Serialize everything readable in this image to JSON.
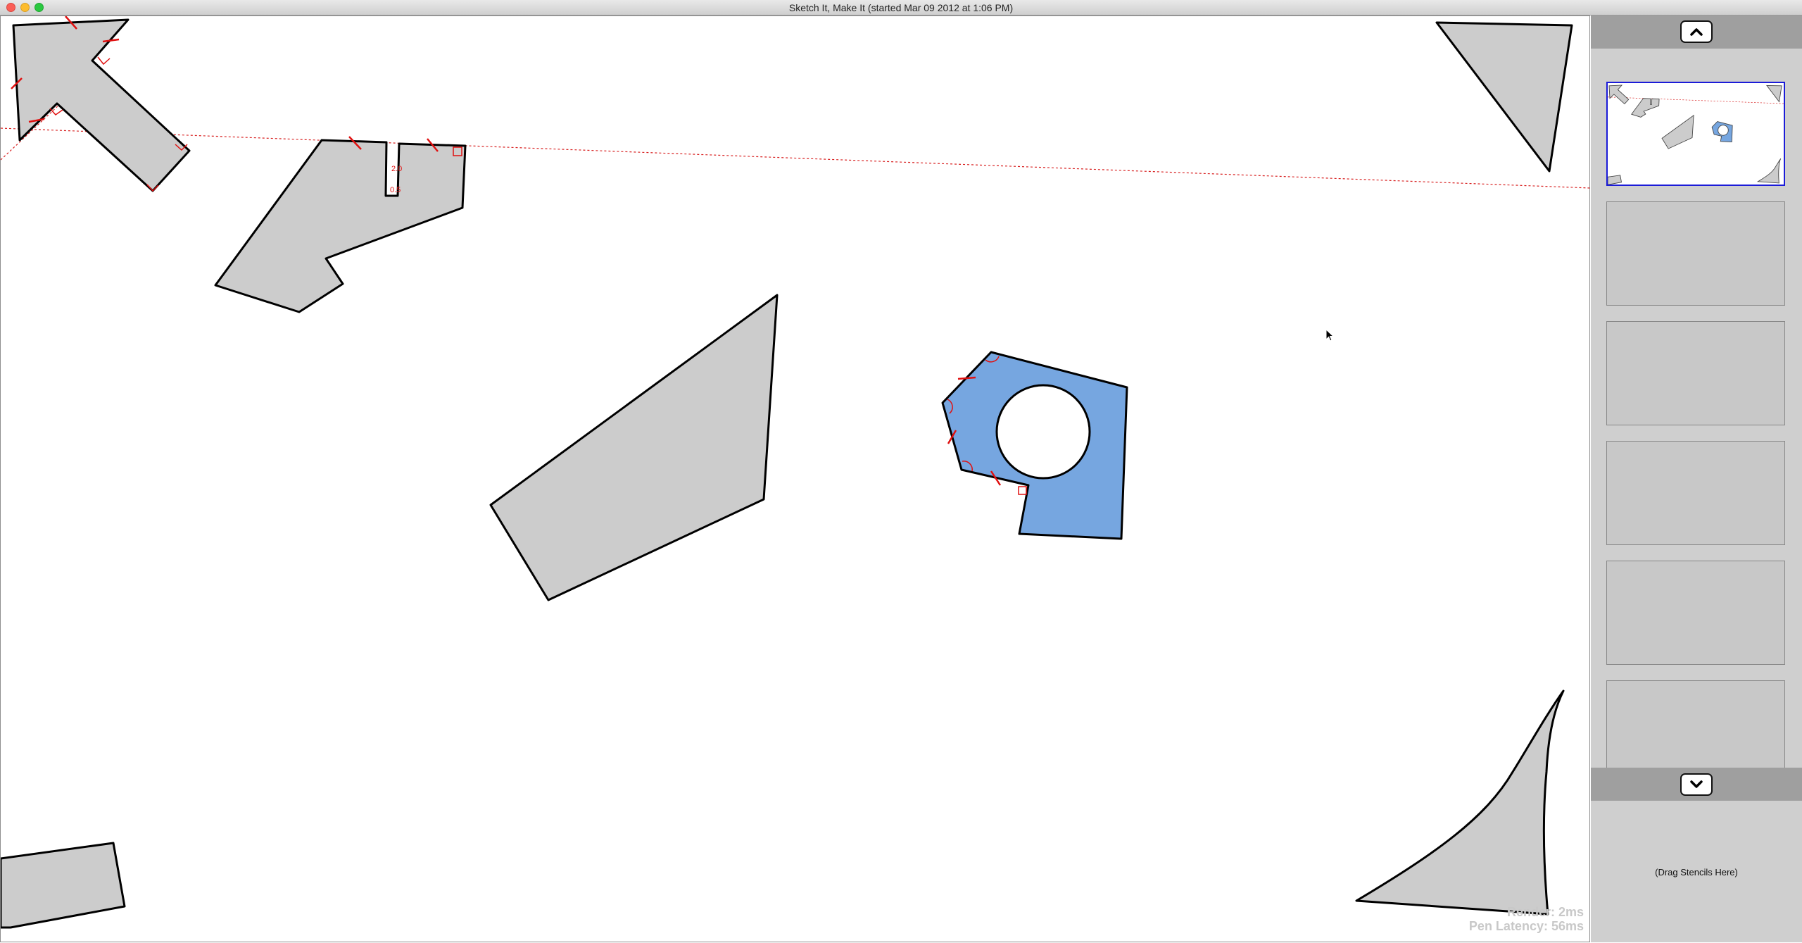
{
  "window": {
    "title": "Sketch It, Make It (started Mar 09 2012 at 1:06 PM)"
  },
  "canvas": {
    "render_label": "Render: 2ms",
    "latency_label": "Pen Latency: 56ms",
    "shape_fill": "#cccccc",
    "selected_fill": "#76a6e0",
    "guide_color": "#d82020",
    "dimension_labels": [
      "2.0",
      "0.5"
    ]
  },
  "sidebar": {
    "scroll_up_icon": "chevron-up-icon",
    "scroll_down_icon": "chevron-down-icon",
    "drop_zone_label": "(Drag Stencils Here)",
    "selection_color": "#1b1bd8"
  }
}
